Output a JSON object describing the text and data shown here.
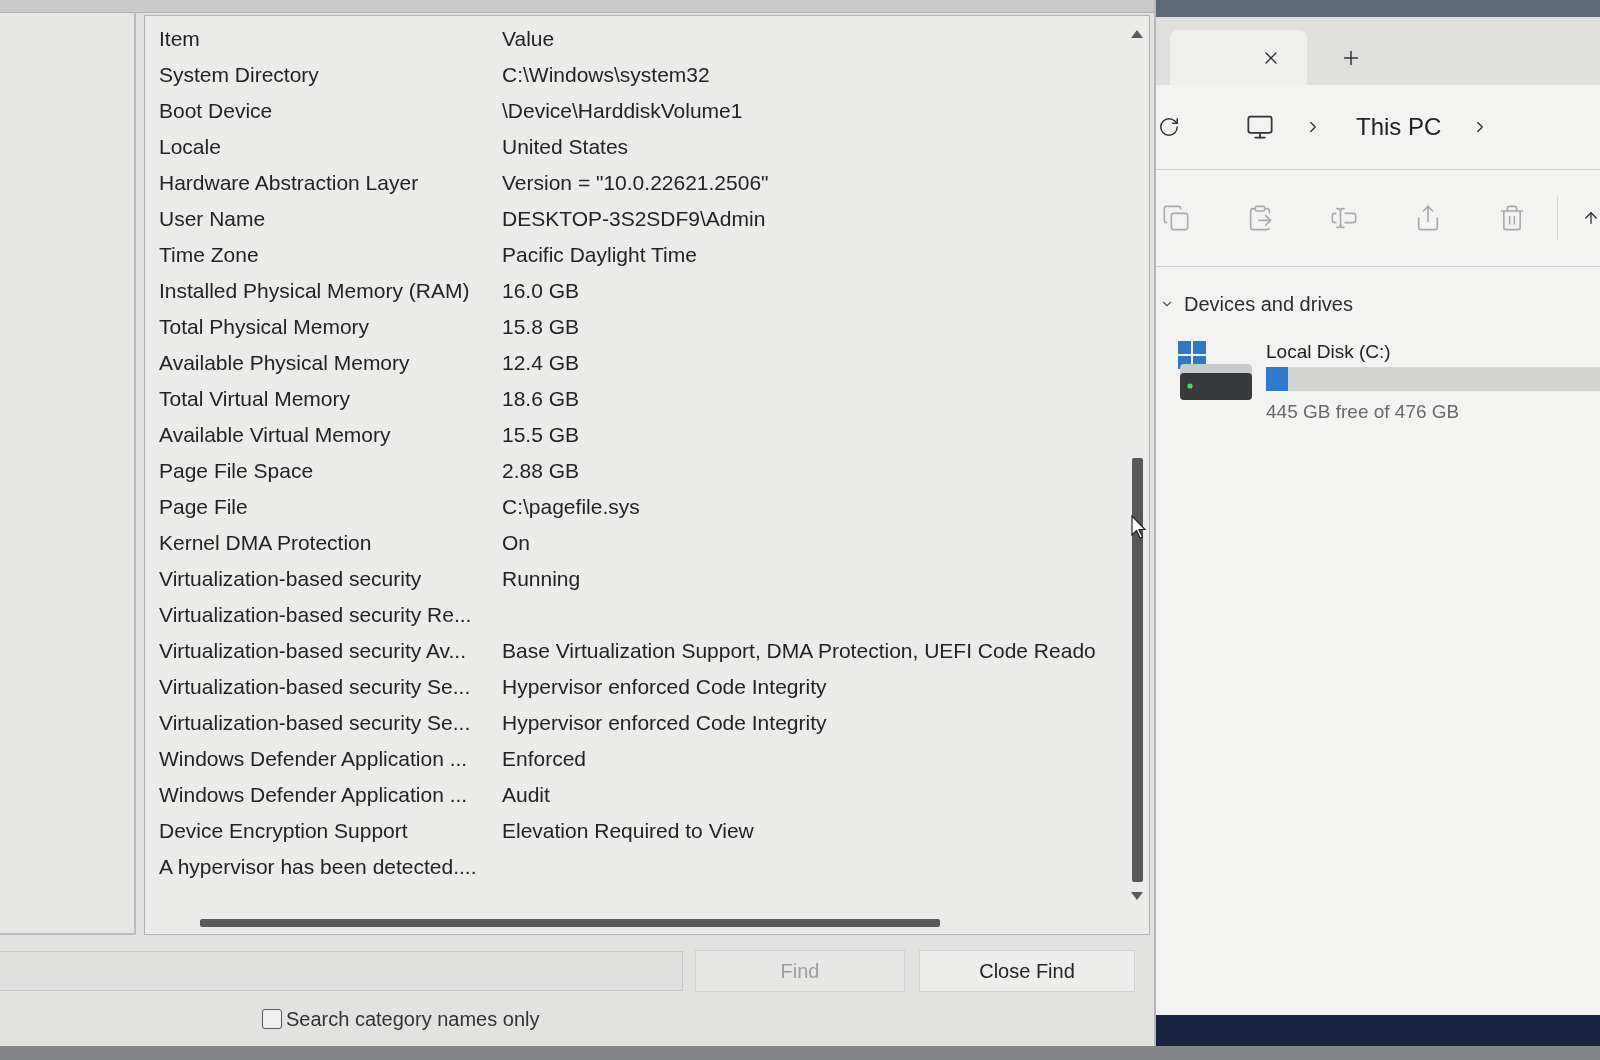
{
  "system_information": {
    "columns": [
      "Item",
      "Value"
    ],
    "rows": [
      {
        "item": "System Directory",
        "value": "C:\\Windows\\system32"
      },
      {
        "item": "Boot Device",
        "value": "\\Device\\HarddiskVolume1"
      },
      {
        "item": "Locale",
        "value": "United States"
      },
      {
        "item": "Hardware Abstraction Layer",
        "value": "Version = \"10.0.22621.2506\""
      },
      {
        "item": "User Name",
        "value": "DESKTOP-3S2SDF9\\Admin"
      },
      {
        "item": "Time Zone",
        "value": "Pacific Daylight Time"
      },
      {
        "item": "Installed Physical Memory (RAM)",
        "value": "16.0 GB"
      },
      {
        "item": "Total Physical Memory",
        "value": "15.8 GB"
      },
      {
        "item": "Available Physical Memory",
        "value": "12.4 GB"
      },
      {
        "item": "Total Virtual Memory",
        "value": "18.6 GB"
      },
      {
        "item": "Available Virtual Memory",
        "value": "15.5 GB"
      },
      {
        "item": "Page File Space",
        "value": "2.88 GB"
      },
      {
        "item": "Page File",
        "value": "C:\\pagefile.sys"
      },
      {
        "item": "Kernel DMA Protection",
        "value": "On"
      },
      {
        "item": "Virtualization-based security",
        "value": "Running"
      },
      {
        "item": "Virtualization-based security Re..."
      },
      {
        "item": "Virtualization-based security Av...",
        "value": "Base Virtualization Support, DMA Protection, UEFI Code Reado"
      },
      {
        "item": "Virtualization-based security Se...",
        "value": "Hypervisor enforced Code Integrity"
      },
      {
        "item": "Virtualization-based security Se...",
        "value": "Hypervisor enforced Code Integrity"
      },
      {
        "item": "Windows Defender Application ...",
        "value": "Enforced"
      },
      {
        "item": "Windows Defender Application ...",
        "value": "Audit"
      },
      {
        "item": "Device Encryption Support",
        "value": "Elevation Required to View"
      },
      {
        "item": "A hypervisor has been detected...."
      }
    ],
    "find_bar": {
      "buttons": [
        {
          "label": "Find",
          "disabled": true
        },
        {
          "label": "Close Find",
          "disabled": false
        }
      ],
      "options": [
        {
          "label": "Search category names only",
          "checked": false
        }
      ]
    }
  },
  "file_explorer": {
    "breadcrumb": [
      "This PC"
    ],
    "toolbar_buttons": [
      {
        "disabled": true
      },
      {
        "disabled": true
      },
      {
        "disabled": true
      },
      {
        "disabled": true
      },
      {
        "disabled": true
      },
      {
        "disabled": false
      }
    ],
    "sections": [
      {
        "title": "Devices and drives",
        "expanded": true,
        "drives": [
          {
            "name": "Local Disk (C:)",
            "level": 0.065,
            "capacity": "445 GB free of 476 GB"
          }
        ]
      }
    ]
  }
}
